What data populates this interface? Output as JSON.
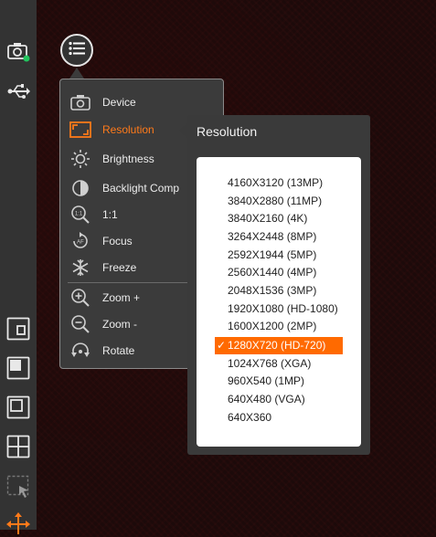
{
  "toolbar": {
    "icons": [
      "camera-icon",
      "usb-icon",
      "pip-small-icon",
      "pip-large-icon",
      "window-icon",
      "grid-icon",
      "select-region-icon",
      "move-icon"
    ],
    "status_dot_color": "#22c55e"
  },
  "menu": {
    "icon": "list-menu-icon",
    "items": [
      {
        "label": "Device",
        "icon": "camera-icon"
      },
      {
        "label": "Resolution",
        "icon": "resolution-icon"
      },
      {
        "label": "Brightness",
        "icon": "sun-icon"
      },
      {
        "label": "Backlight Comp",
        "icon": "contrast-icon"
      },
      {
        "label": "1:1",
        "icon": "zoom-1-1-icon"
      },
      {
        "label": "Focus",
        "icon": "autofocus-icon"
      },
      {
        "label": "Freeze",
        "icon": "snowflake-icon"
      },
      {
        "label": "Zoom +",
        "icon": "zoom-in-icon"
      },
      {
        "label": "Zoom -",
        "icon": "zoom-out-icon"
      },
      {
        "label": "Rotate",
        "icon": "rotate-icon"
      }
    ],
    "active_item": "Resolution",
    "accent_color": "#ff7a1a"
  },
  "resolution_panel": {
    "title": "Resolution",
    "options": [
      "4160X3120 (13MP)",
      "3840X2880 (11MP)",
      "3840X2160 (4K)",
      "3264X2448 (8MP)",
      "2592X1944 (5MP)",
      "2560X1440 (4MP)",
      "2048X1536 (3MP)",
      "1920X1080 (HD-1080)",
      "1600X1200 (2MP)",
      "1280X720 (HD-720)",
      "1024X768 (XGA)",
      "960X540 (1MP)",
      "640X480 (VGA)",
      "640X360"
    ],
    "selected": "1280X720 (HD-720)",
    "check_mark": "✓"
  }
}
